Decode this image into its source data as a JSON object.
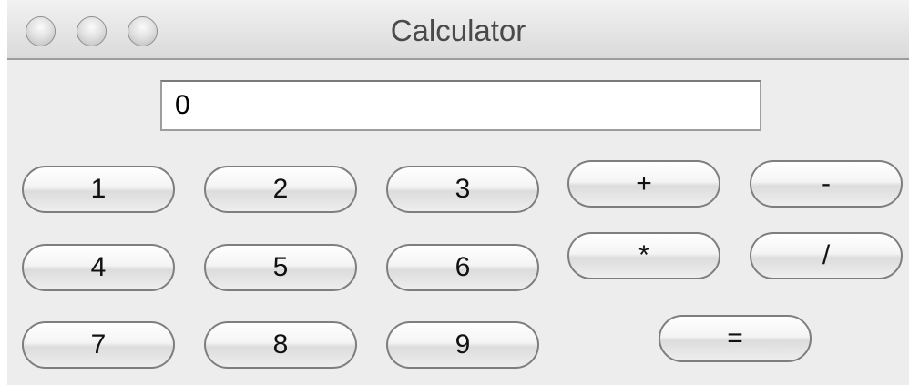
{
  "window": {
    "title": "Calculator"
  },
  "display": {
    "value": "0"
  },
  "keys": {
    "k1": "1",
    "k2": "2",
    "k3": "3",
    "k4": "4",
    "k5": "5",
    "k6": "6",
    "k7": "7",
    "k8": "8",
    "k9": "9",
    "plus": "+",
    "minus": "-",
    "multiply": "*",
    "divide": "/",
    "equals": "="
  }
}
